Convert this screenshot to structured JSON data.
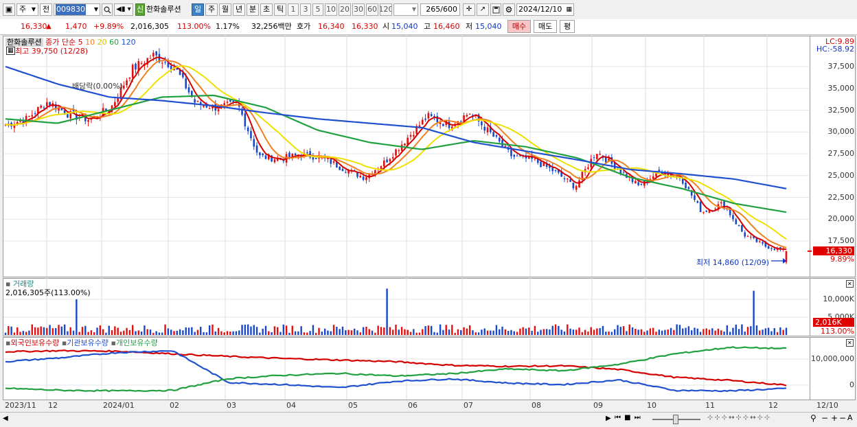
{
  "toolbar": {
    "type_select": "주",
    "prefix": "전",
    "code": "009830",
    "name": "한화솔루션",
    "badge": "신",
    "periods": [
      "일",
      "주",
      "월",
      "년",
      "분",
      "초",
      "틱"
    ],
    "selected_period": "일",
    "intervals": [
      "1",
      "3",
      "5",
      "10",
      "20",
      "30",
      "60",
      "120"
    ],
    "count": "265",
    "count_total": "/600",
    "date": "2024/12/10"
  },
  "quote": {
    "price": "16,330",
    "arrow": "▲",
    "change": "1,470",
    "change_pct": "+9.89%",
    "volume": "2,016,305",
    "volume_ratio": "113.00%",
    "turnover": "1.17%",
    "amount": "32,256백만",
    "bid_label": "호가",
    "bid1": "16,340",
    "bid2": "16,330",
    "open_label": "시",
    "open": "15,040",
    "high_label": "고",
    "high": "16,460",
    "low_label": "저",
    "low": "15,040",
    "buy_label": "매수",
    "sell_label": "매도",
    "avg_label": "평"
  },
  "price_panel": {
    "legend_name": "한화솔루션",
    "legend_series": "종가 단순",
    "ma_periods": [
      "5",
      "10",
      "20",
      "60",
      "120"
    ],
    "ma_colors": [
      "#d40000",
      "#f08020",
      "#f0e000",
      "#20a040",
      "#2050d0"
    ],
    "high_note": "최고 39,750 (12/28)",
    "low_note": "최저 14,860 (12/09)",
    "dividend_note": "배당락(0.00%)",
    "lc": "LC:9.89",
    "hc": "HC:-58.92",
    "price_tag": "16,330",
    "pct_tag": "9.89%"
  },
  "volume_panel": {
    "title": "거래량",
    "current": "2,016,305주(113.00%)",
    "tag_vol": "2,016K",
    "tag_pct": "113.00%"
  },
  "holder_panel": {
    "series": [
      {
        "name": "외국인보유수량",
        "color": "#d40000"
      },
      {
        "name": "기관보유수량",
        "color": "#2050d0"
      },
      {
        "name": "개인보유수량",
        "color": "#20a040"
      }
    ]
  },
  "x_axis": [
    "2023/11",
    "12",
    "2024/01",
    "02",
    "03",
    "04",
    "05",
    "06",
    "07",
    "08",
    "09",
    "10",
    "11",
    "12",
    "12/10"
  ],
  "chart_data": [
    {
      "type": "candlestick",
      "title": "",
      "y_ticks": [
        17500,
        20000,
        22500,
        25000,
        27500,
        30000,
        32500,
        35000,
        37500
      ],
      "ylim": [
        14860,
        39750
      ],
      "x_categories": [
        "2023/11",
        "12",
        "2024/01",
        "02",
        "03",
        "04",
        "05",
        "06",
        "07",
        "08",
        "09",
        "10",
        "11",
        "12"
      ],
      "close": [
        30800,
        31500,
        33500,
        32000,
        31400,
        32800,
        37200,
        38800,
        37500,
        33300,
        32800,
        33200,
        27200,
        26900,
        27400,
        27100,
        25800,
        24800,
        26600,
        29200,
        31800,
        30800,
        32200,
        29800,
        27200,
        26800,
        25500,
        23700,
        27800,
        25800,
        23800,
        25500,
        24800,
        20800,
        21800,
        18200,
        16900,
        16330
      ],
      "ma120": [
        37500,
        35500,
        34000,
        33600,
        33000,
        32200,
        31500,
        31000,
        30500,
        28800,
        27800,
        26800,
        25700,
        25200,
        24600,
        23500
      ],
      "ma60": [
        31500,
        31000,
        32500,
        34000,
        34200,
        32800,
        30200,
        28800,
        28000,
        29000,
        28300,
        27000,
        24800,
        23500,
        21800,
        20800
      ],
      "high_value": 39750,
      "low_value": 14860,
      "last_price": 16330
    },
    {
      "type": "bar",
      "title": "거래량",
      "y_ticks": [
        5000000,
        10000000
      ],
      "current": 2016305,
      "spikes": [
        {
          "month": "12",
          "value": 10000000
        },
        {
          "month": "05",
          "value": 13000000
        },
        {
          "month": "11",
          "value": 12400000
        }
      ]
    },
    {
      "type": "line",
      "title": "",
      "y_ticks": [
        0,
        10000000
      ],
      "series": [
        {
          "name": "외국인보유수량",
          "values": [
            12800000,
            13200000,
            13000000,
            12000000,
            11000000,
            10200000,
            9600000,
            9000000,
            7600000,
            7200000,
            7400000,
            6000000,
            3000000,
            1800000,
            0
          ]
        },
        {
          "name": "기관보유수량",
          "values": [
            9000000,
            10500000,
            12500000,
            13200000,
            1000000,
            200000,
            -1000000,
            1500000,
            2400000,
            800000,
            200000,
            2000000,
            -2000000,
            -2200000,
            -1300000
          ]
        },
        {
          "name": "개인보유수량",
          "values": [
            -1200000,
            -2000000,
            -2200000,
            -2000000,
            2500000,
            3800000,
            4500000,
            3500000,
            4400000,
            6200000,
            5500000,
            8000000,
            12000000,
            14500000,
            14000000
          ]
        }
      ]
    }
  ]
}
